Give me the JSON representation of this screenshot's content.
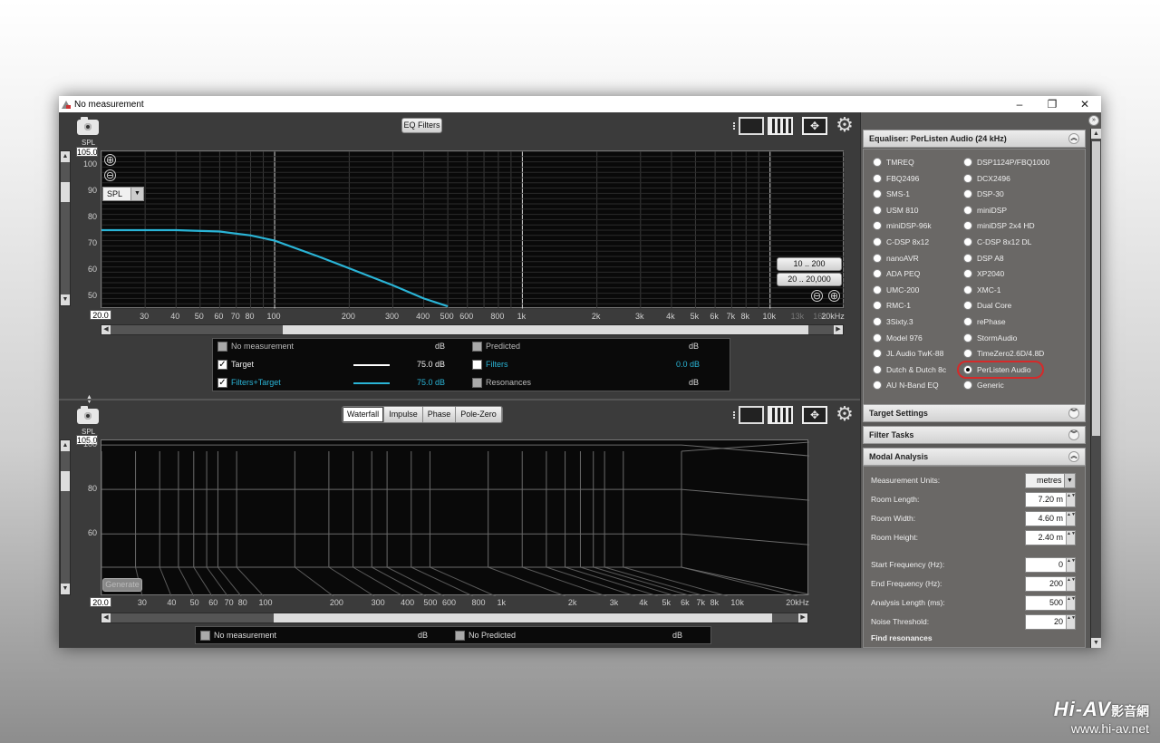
{
  "window": {
    "title": "No measurement",
    "minimize": "–",
    "restore": "❐",
    "close": "✕"
  },
  "top_toolbar": {
    "eq_filters_label": "EQ Filters"
  },
  "bottom_toolbar": {
    "tabs": [
      "Waterfall",
      "Impulse",
      "Phase",
      "Pole-Zero"
    ],
    "active_tab": "Waterfall"
  },
  "top_graph": {
    "spl_label": "SPL",
    "spl_max": "105.0",
    "y_ticks": [
      "100",
      "90",
      "80",
      "70",
      "60",
      "50"
    ],
    "x_min_box": "20.0",
    "x_ticks": [
      "30",
      "40",
      "50",
      "60",
      "70",
      "80",
      "100",
      "200",
      "300",
      "400",
      "500",
      "600",
      "800",
      "1k",
      "2k",
      "3k",
      "4k",
      "5k",
      "6k",
      "7k",
      "8k",
      "10k",
      "13k",
      "16k",
      "20kHz"
    ],
    "x_ticks_dim": [
      "13k",
      "16k"
    ],
    "zoom_in": "⊕",
    "zoom_out": "⊖",
    "spl_select": "SPL",
    "range_buttons": [
      "10 .. 200",
      "20 .. 20,000"
    ],
    "range_zoom_out": "⊖",
    "range_zoom_in": "⊕"
  },
  "top_legend": {
    "rows": [
      {
        "left_label": "No measurement",
        "left_value": "",
        "left_unit": "dB",
        "left_checked": false,
        "left_enabled": false,
        "right_label": "Predicted",
        "right_unit": "dB",
        "right_value": "",
        "right_checked": false,
        "right_enabled": false
      },
      {
        "left_label": "Target",
        "left_value": "75.0 dB",
        "left_unit": "",
        "left_checked": true,
        "left_enabled": true,
        "right_label": "Filters",
        "right_unit": "",
        "right_value": "0.0 dB",
        "right_checked": false,
        "right_enabled": true
      },
      {
        "left_label": "Filters+Target",
        "left_value": "75.0 dB",
        "left_unit": "",
        "left_checked": true,
        "left_enabled": true,
        "right_label": "Resonances",
        "right_unit": "dB",
        "right_value": "",
        "right_checked": false,
        "right_enabled": false
      }
    ],
    "check_mark": "✓"
  },
  "bottom_graph": {
    "spl_label": "SPL",
    "spl_max": "105.0",
    "y_ticks": [
      "100",
      "80",
      "60"
    ],
    "x_min_box": "20.0",
    "x_ticks": [
      "30",
      "40",
      "50",
      "60",
      "70",
      "80",
      "100",
      "200",
      "300",
      "400",
      "500",
      "600",
      "800",
      "1k",
      "2k",
      "3k",
      "4k",
      "5k",
      "6k",
      "7k",
      "8k",
      "10k",
      "20kHz"
    ],
    "generate_label": "Generate"
  },
  "bottom_legend": {
    "left_label": "No measurement",
    "left_unit": "dB",
    "right_label": "No Predicted",
    "right_unit": "dB"
  },
  "right_panel": {
    "equaliser_header": "Equaliser: PerListen Audio (24 kHz)",
    "equalisers_left": [
      "TMREQ",
      "FBQ2496",
      "SMS-1",
      "USM 810",
      "miniDSP-96k",
      "C-DSP 8x12",
      "nanoAVR",
      "ADA PEQ",
      "UMC-200",
      "RMC-1",
      "3Sixty.3",
      "Model 976",
      "JL Audio TwK-88",
      "Dutch & Dutch 8c",
      "AU N-Band EQ"
    ],
    "equalisers_right": [
      "DSP1124P/FBQ1000",
      "DCX2496",
      "DSP-30",
      "miniDSP",
      "miniDSP 2x4 HD",
      "C-DSP 8x12 DL",
      "DSP A8",
      "XP2040",
      "XMC-1",
      "Dual Core",
      "rePhase",
      "StormAudio",
      "TimeZero2.6D/4.8D",
      "PerListen Audio",
      "Generic"
    ],
    "selected": "PerListen Audio",
    "target_settings_header": "Target Settings",
    "filter_tasks_header": "Filter Tasks",
    "modal_analysis_header": "Modal Analysis",
    "modal_fields": [
      {
        "label": "Measurement Units:",
        "value": "metres",
        "type": "select"
      },
      {
        "label": "Room Length:",
        "value": "7.20 m",
        "type": "spin"
      },
      {
        "label": "Room Width:",
        "value": "4.60 m",
        "type": "spin"
      },
      {
        "label": "Room Height:",
        "value": "2.40 m",
        "type": "spin"
      },
      {
        "label": "Start Frequency (Hz):",
        "value": "0",
        "type": "spin"
      },
      {
        "label": "End Frequency (Hz):",
        "value": "200",
        "type": "spin"
      },
      {
        "label": "Analysis Length (ms):",
        "value": "500",
        "type": "spin"
      },
      {
        "label": "Noise Threshold:",
        "value": "20",
        "type": "spin"
      }
    ],
    "find_resonances": "Find resonances",
    "collapse_glyph": "︽",
    "expand_glyph": "︾"
  },
  "watermark": {
    "logo": "Hi-AV",
    "cjk": "影音網",
    "url": "www.hi-av.net"
  },
  "colors": {
    "target_line": "#ffffff",
    "filters_target_line": "#2ab4d6",
    "highlight": "#d52a2a"
  },
  "chart_data": {
    "type": "line",
    "x_scale": "log",
    "xlim": [
      20,
      20000
    ],
    "ylim": [
      45,
      105
    ],
    "ylabel": "SPL",
    "series": [
      {
        "name": "Filters+Target",
        "x": [
          20,
          40,
          60,
          80,
          100,
          150,
          200,
          300,
          400,
          500
        ],
        "values": [
          75,
          75,
          74.5,
          73,
          71,
          65,
          60.5,
          54,
          49,
          46
        ]
      }
    ]
  }
}
